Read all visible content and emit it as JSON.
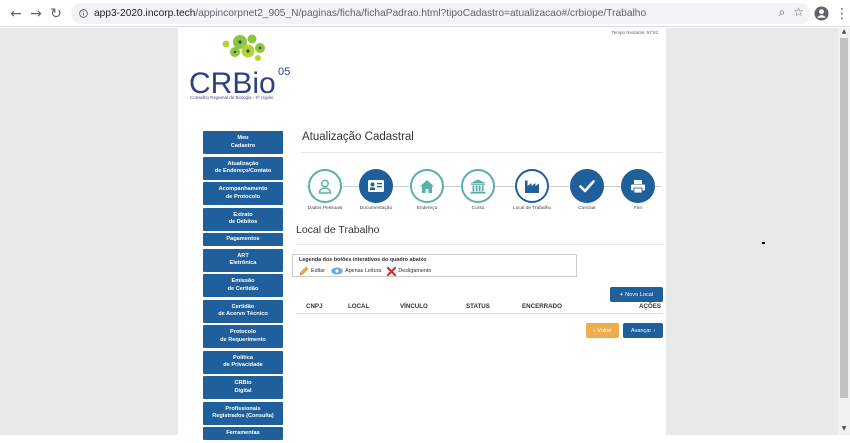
{
  "browser": {
    "url_host": "app3-2020.incorp.tech",
    "url_path": "/appincorpnet2_905_N/paginas/ficha/fichaPadrao.html?tipoCadastro=atualizacao#/crbiope/Trabalho"
  },
  "header": {
    "timer": "Tempo Restante: 57:52",
    "logo_text": "CRBio",
    "logo_superscript": "05",
    "logo_subtitle": "Conselho Regional de Biologia - 5ª região"
  },
  "sidebar": {
    "items": [
      {
        "label": "Meu\nCadastro"
      },
      {
        "label": "Atualização\nde Endereço/Contato"
      },
      {
        "label": "Acompanhamento\nde Protocolo"
      },
      {
        "label": "Extrato\nde Débitos"
      },
      {
        "label": "Pagamentos"
      },
      {
        "label": "ART\nEletrônica"
      },
      {
        "label": "Emissão\nde Certidão"
      },
      {
        "label": "Certidão\nde Acervo Técnico"
      },
      {
        "label": "Protocolo\nde Requerimento"
      },
      {
        "label": "Política\nde Privacidade"
      },
      {
        "label": "CRBio\nDigital"
      },
      {
        "label": "Profissionais\nRegistrados (Consulta)"
      },
      {
        "label": "Ferramentas"
      }
    ]
  },
  "main": {
    "title": "Atualização Cadastral",
    "steps": [
      {
        "label": "Dados Pessoais",
        "icon": "user-icon",
        "state": "done"
      },
      {
        "label": "Documentação",
        "icon": "id-card-icon",
        "state": "active"
      },
      {
        "label": "Endereço",
        "icon": "home-icon",
        "state": "done"
      },
      {
        "label": "Curso",
        "icon": "institution-icon",
        "state": "done"
      },
      {
        "label": "Local de Trabalho",
        "icon": "industry-icon",
        "state": "current"
      },
      {
        "label": "Concluir",
        "icon": "check-icon",
        "state": "pending"
      },
      {
        "label": "Fim",
        "icon": "printer-icon",
        "state": "pending"
      }
    ],
    "section_title": "Local de Trabalho",
    "legend": {
      "title": "Legenda dos botões interativos do quadro abaixo",
      "edit": "Editar",
      "readonly": "Apenas Leitura",
      "unlink": "Desligamento"
    },
    "new_button": "Novo Local",
    "table_headers": [
      "CNPJ",
      "LOCAL",
      "VÍNCULO",
      "STATUS",
      "ENCERRADO",
      "AÇÕES"
    ],
    "back_button": "Voltar",
    "next_button": "Avançar"
  },
  "colors": {
    "primary": "#1f5f9b",
    "teal": "#5ab0a4",
    "warning": "#f0ad4e",
    "logo_green": "#8dc63f"
  }
}
